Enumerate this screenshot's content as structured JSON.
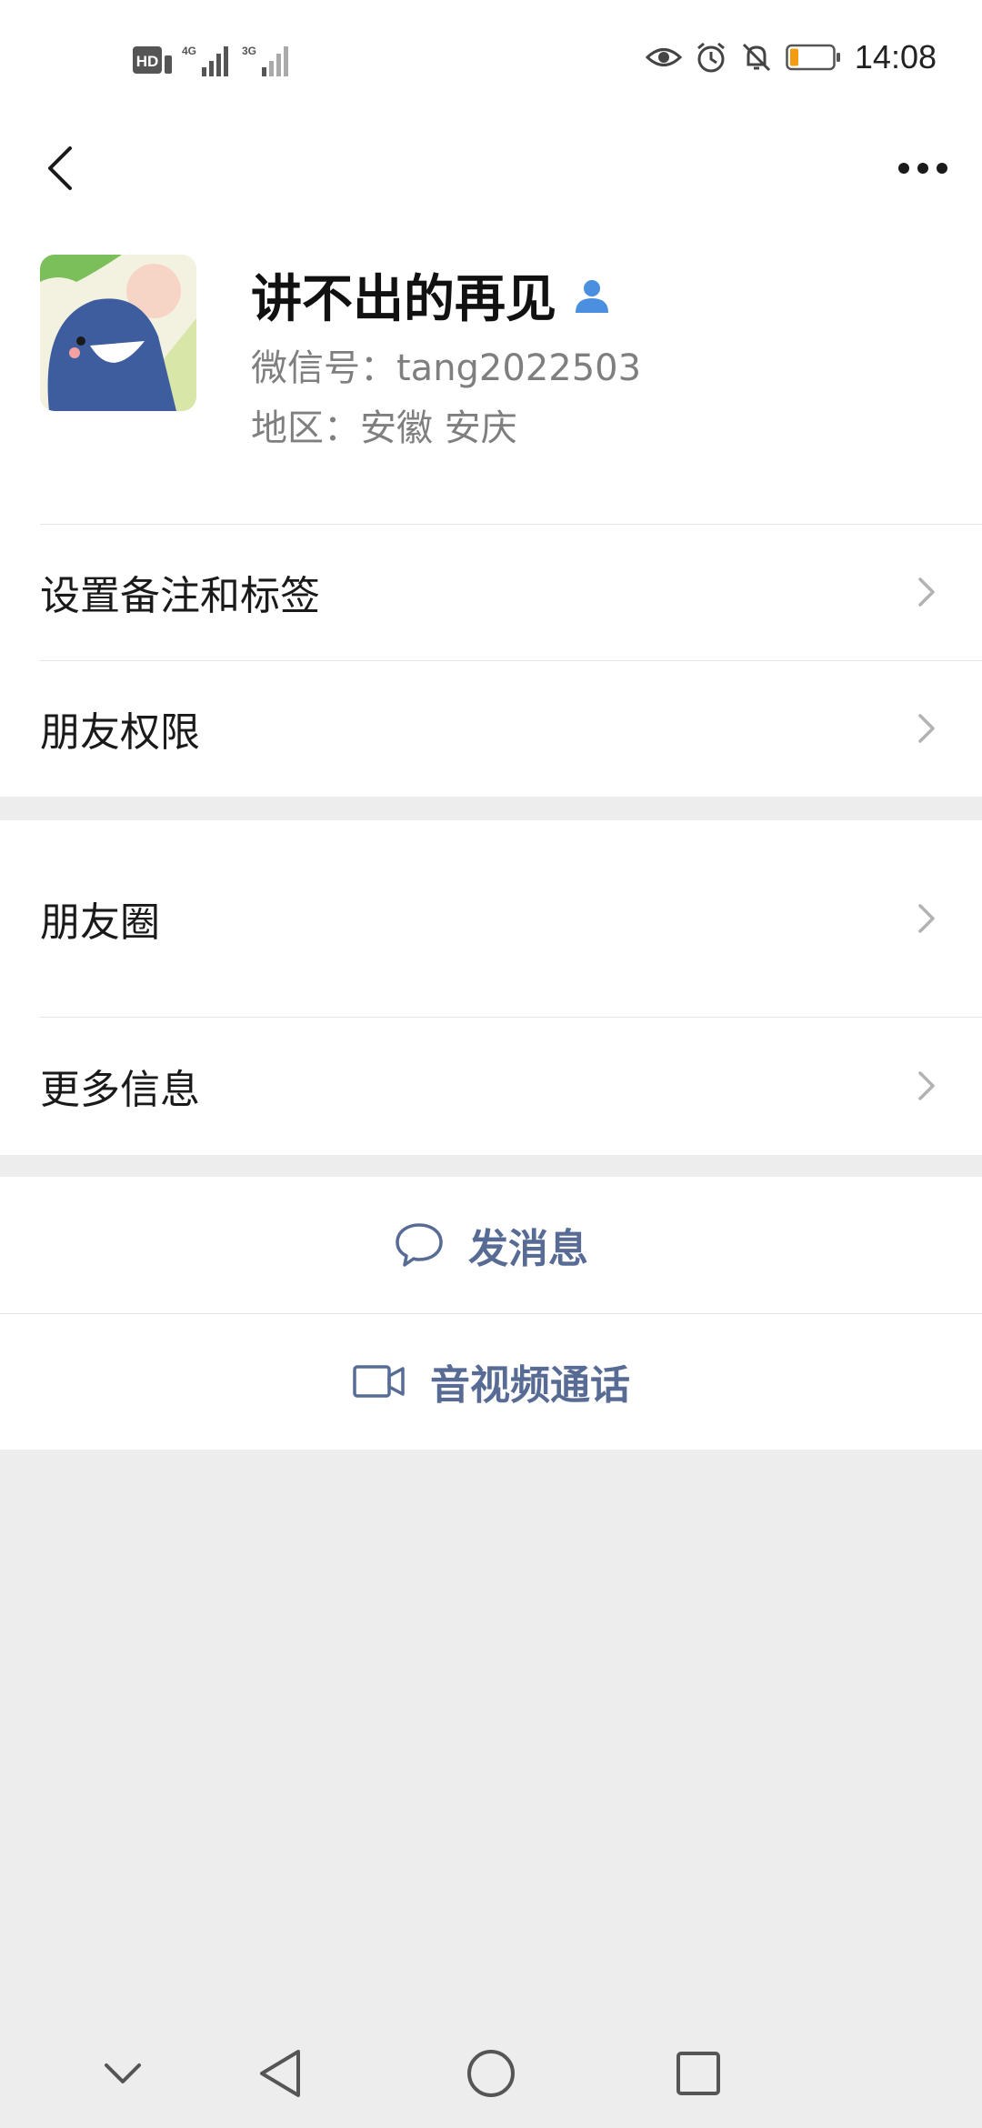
{
  "status_bar": {
    "network_labels": [
      "HD",
      "4G",
      "3G"
    ],
    "time": "14:08",
    "battery_color": "#f39c12"
  },
  "nav": {
    "back_icon": "back-chevron-icon",
    "more_icon": "more-dots-icon"
  },
  "profile": {
    "name": "讲不出的再见",
    "wechat_id": "微信号：tang2022503",
    "region": "地区：安徽  安庆",
    "badge_icon": "contact-person-icon",
    "badge_color": "#4a8fe0"
  },
  "menu_group_1": [
    {
      "label": "设置备注和标签"
    },
    {
      "label": "朋友权限"
    }
  ],
  "menu_group_2": [
    {
      "label": "朋友圈"
    },
    {
      "label": "更多信息"
    }
  ],
  "actions": {
    "message_label": "发消息",
    "call_label": "音视频通话",
    "accent": "#576b95"
  }
}
